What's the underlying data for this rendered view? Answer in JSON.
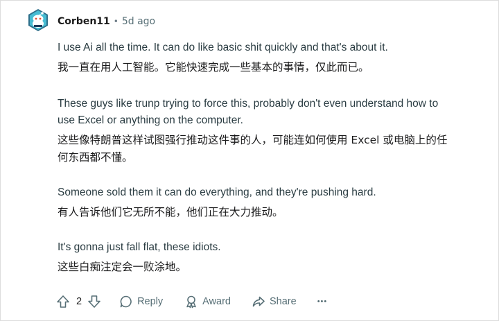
{
  "comment": {
    "author": "Corben11",
    "separator": "•",
    "age": "5d ago",
    "paragraphs": [
      {
        "en": "I use Ai all the time. It can do like basic shit quickly and that's about it.",
        "zh": "我一直在用人工智能。它能快速完成一些基本的事情，仅此而已。"
      },
      {
        "en": "These guys like trunp trying to force this, probably don't even understand how to use Excel or anything on the computer.",
        "zh": "这些像特朗普这样试图强行推动这件事的人，可能连如何使用 Excel 或电脑上的任何东西都不懂。"
      },
      {
        "en": "Someone sold them it can do everything, and they're pushing hard.",
        "zh": "有人告诉他们它无所不能，他们正在大力推动。"
      },
      {
        "en": "It's gonna just fall flat, these idiots.",
        "zh": "这些白痴注定会一败涂地。"
      }
    ]
  },
  "actions": {
    "vote_count": "2",
    "reply_label": "Reply",
    "award_label": "Award",
    "share_label": "Share",
    "more_label": "•••"
  },
  "colors": {
    "avatar_bg": "#46c1d6",
    "avatar_dark": "#1f3a5a",
    "meta_text": "#576f76",
    "body_text": "#2a3c42"
  }
}
